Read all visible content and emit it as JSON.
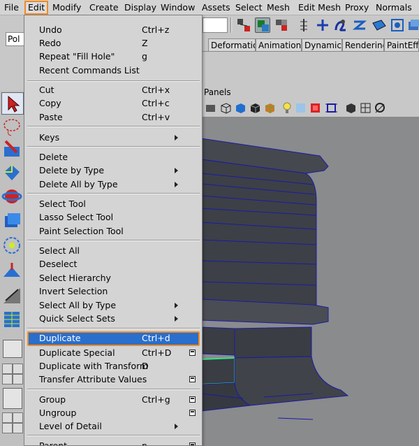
{
  "menubar": {
    "items": [
      "File",
      "Edit",
      "Modify",
      "Create",
      "Display",
      "Window",
      "Assets",
      "Select",
      "Mesh",
      "Edit Mesh",
      "Proxy",
      "Normals"
    ],
    "active": "Edit",
    "highlight_color": "#f08a24"
  },
  "field": {
    "value": "Pol"
  },
  "shelf": {
    "tabs": [
      "Deformation",
      "Animation",
      "Dynamics",
      "Rendering",
      "PaintEffe"
    ]
  },
  "panel": {
    "menu_label": "Panels"
  },
  "edit_menu": {
    "items": [
      {
        "label": "Undo",
        "shortcut": "Ctrl+z"
      },
      {
        "label": "Redo",
        "shortcut": "Z"
      },
      {
        "label": "Repeat \"Fill Hole\"",
        "shortcut": "g"
      },
      {
        "label": "Recent Commands List",
        "shortcut": ""
      },
      {
        "label": "Cut",
        "shortcut": "Ctrl+x"
      },
      {
        "label": "Copy",
        "shortcut": "Ctrl+c"
      },
      {
        "label": "Paste",
        "shortcut": "Ctrl+v"
      },
      {
        "label": "Keys",
        "shortcut": ""
      },
      {
        "label": "Delete",
        "shortcut": ""
      },
      {
        "label": "Delete by Type",
        "shortcut": ""
      },
      {
        "label": "Delete All by Type",
        "shortcut": ""
      },
      {
        "label": "Select Tool",
        "shortcut": ""
      },
      {
        "label": "Lasso Select Tool",
        "shortcut": ""
      },
      {
        "label": "Paint Selection Tool",
        "shortcut": ""
      },
      {
        "label": "Select All",
        "shortcut": ""
      },
      {
        "label": "Deselect",
        "shortcut": ""
      },
      {
        "label": "Select Hierarchy",
        "shortcut": ""
      },
      {
        "label": "Invert Selection",
        "shortcut": ""
      },
      {
        "label": "Select All by Type",
        "shortcut": ""
      },
      {
        "label": "Quick Select Sets",
        "shortcut": ""
      },
      {
        "label": "Duplicate",
        "shortcut": "Ctrl+d"
      },
      {
        "label": "Duplicate Special",
        "shortcut": "Ctrl+D"
      },
      {
        "label": "Duplicate with Transform",
        "shortcut": "D"
      },
      {
        "label": "Transfer Attribute Values",
        "shortcut": ""
      },
      {
        "label": "Group",
        "shortcut": "Ctrl+g"
      },
      {
        "label": "Ungroup",
        "shortcut": ""
      },
      {
        "label": "Level of Detail",
        "shortcut": ""
      },
      {
        "label": "Parent",
        "shortcut": "p"
      }
    ],
    "highlighted": "Duplicate",
    "highlight_bg": "#2a6fcb"
  },
  "colors": {
    "viewport_bg": "#8a8b8d",
    "mesh_face": "#3d4046",
    "wireframe": "#1a1aa8",
    "selection": "#36e08a"
  }
}
